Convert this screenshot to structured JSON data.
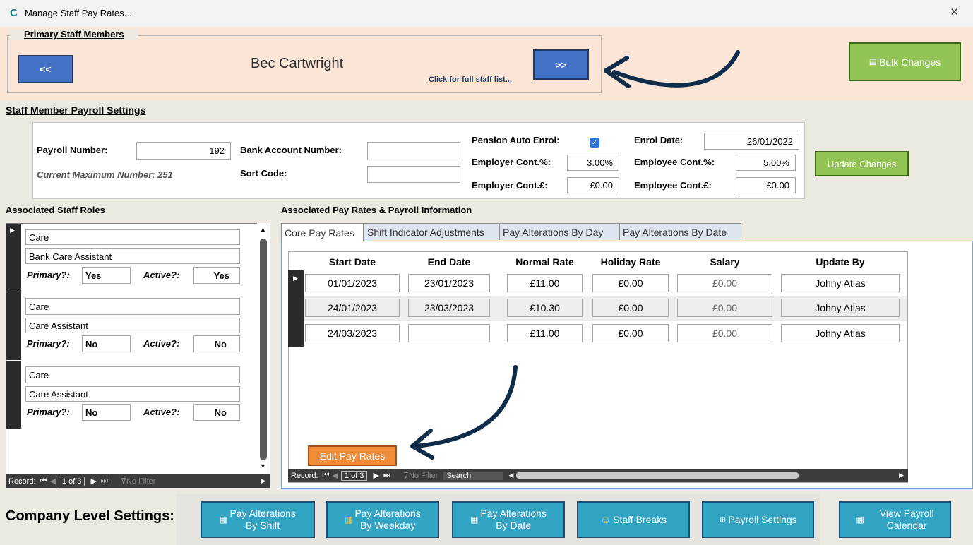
{
  "window": {
    "title": "Manage Staff Pay Rates...",
    "app_icon": "C",
    "close": "×"
  },
  "primary": {
    "legend": "Primary Staff Members",
    "prev_label": "<<",
    "next_label": ">>",
    "staff_name": "Bec Cartwright",
    "full_list_link": "Click for full staff list..."
  },
  "bulk_changes_label": "Bulk Changes",
  "payroll": {
    "section_title": "Staff Member Payroll Settings",
    "payroll_number_label": "Payroll Number:",
    "payroll_number": "192",
    "max_number_text": "Current Maximum Number: 251",
    "bank_account_label": "Bank Account Number:",
    "bank_account": "",
    "sort_code_label": "Sort Code:",
    "sort_code": "",
    "pension_label": "Pension Auto Enrol:",
    "pension_checked": true,
    "enrol_date_label": "Enrol Date:",
    "enrol_date": "26/01/2022",
    "employer_pct_label": "Employer Cont.%:",
    "employer_pct": "3.00%",
    "employee_pct_label": "Employee Cont.%:",
    "employee_pct": "5.00%",
    "employer_gbp_label": "Employer Cont.£:",
    "employer_gbp": "£0.00",
    "employee_gbp_label": "Employee Cont.£:",
    "employee_gbp": "£0.00",
    "update_label": "Update Changes"
  },
  "roles": {
    "title": "Associated Staff Roles",
    "primary_label": "Primary?:",
    "active_label": "Active?:",
    "items": [
      {
        "category": "Care",
        "role": "Bank Care Assistant",
        "primary": "Yes",
        "active": "Yes"
      },
      {
        "category": "Care",
        "role": "Care Assistant",
        "primary": "No",
        "active": "No"
      },
      {
        "category": "Care",
        "role": "Care Assistant",
        "primary": "No",
        "active": "No"
      }
    ],
    "nav": {
      "record_label": "Record:",
      "position": "1 of 3",
      "filter": "No Filter"
    }
  },
  "payrates": {
    "title": "Associated Pay Rates & Payroll Information",
    "tabs": [
      "Core Pay Rates",
      "Shift Indicator Adjustments",
      "Pay Alterations By Day",
      "Pay Alterations By Date"
    ],
    "columns": [
      "Start Date",
      "End Date",
      "Normal Rate",
      "Holiday Rate",
      "Salary",
      "Update By"
    ],
    "rows": [
      [
        "01/01/2023",
        "23/01/2023",
        "£11.00",
        "£0.00",
        "£0.00",
        "Johny Atlas"
      ],
      [
        "24/01/2023",
        "23/03/2023",
        "£10.30",
        "£0.00",
        "£0.00",
        "Johny Atlas"
      ],
      [
        "24/03/2023",
        "",
        "£11.00",
        "£0.00",
        "£0.00",
        "Johny Atlas"
      ]
    ],
    "edit_label": "Edit Pay Rates",
    "nav": {
      "record_label": "Record:",
      "position": "1 of 3",
      "filter": "No Filter",
      "search": "Search"
    }
  },
  "company": {
    "title": "Company Level Settings:",
    "buttons": [
      {
        "line1": "Pay Alterations",
        "line2": "By Shift"
      },
      {
        "line1": "Pay Alterations",
        "line2": "By Weekday"
      },
      {
        "line1": "Pay Alterations",
        "line2": "By Date"
      },
      {
        "line1": "Staff Breaks",
        "line2": ""
      },
      {
        "line1": "Payroll Settings",
        "line2": ""
      },
      {
        "line1": "View Payroll",
        "line2": "Calendar"
      }
    ]
  },
  "colors": {
    "accent_blue": "#4472c4",
    "green": "#92c355",
    "orange": "#f08c38",
    "teal": "#31a3c3",
    "peach": "#fbe5d6"
  }
}
